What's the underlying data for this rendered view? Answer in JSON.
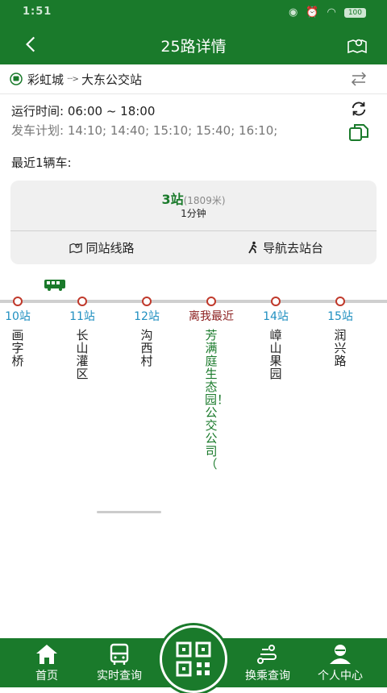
{
  "status": {
    "time": "1:51",
    "battery": "100"
  },
  "header": {
    "title": "25路详情"
  },
  "route": {
    "from": "彩虹城",
    "arrow": "···>",
    "to": "大东公交站"
  },
  "info": {
    "operating_hours": "运行时间: 06:00 ~ 18:00",
    "schedule": "发车计划: 14:10; 14:40; 15:10; 15:40; 16:10;"
  },
  "recent_label": "最近1辆车:",
  "card": {
    "stops_away": "3站",
    "distance": "(1809米)",
    "eta": "1分钟",
    "same_station_label": "同站线路",
    "navigate_label": "导航去站台"
  },
  "stops": [
    {
      "index": "10站",
      "name": "画字桥",
      "near": false
    },
    {
      "index": "11站",
      "name": "长山灌区",
      "near": false
    },
    {
      "index": "12站",
      "name": "沟西村",
      "near": false
    },
    {
      "index": "离我最近",
      "name": "芳满庭生态园！公交公司（",
      "near": true
    },
    {
      "index": "14站",
      "name": "嶂山果园",
      "near": false
    },
    {
      "index": "15站",
      "name": "润兴路",
      "near": false
    }
  ],
  "nav": {
    "home": "首页",
    "realtime": "实时查询",
    "transfer": "换乘查询",
    "profile": "个人中心"
  },
  "colors": {
    "brand": "#1a7a2b",
    "stop_index": "#1f8fc0",
    "nearest": "#8b1e1e"
  }
}
